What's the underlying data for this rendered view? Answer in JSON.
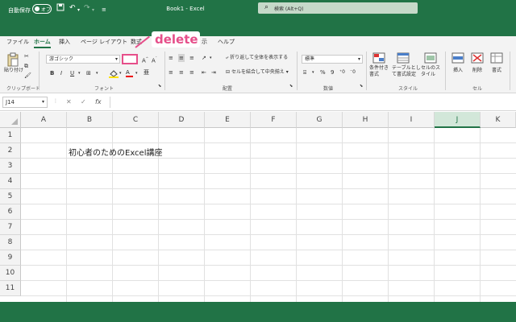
{
  "titlebar": {
    "autosave_label": "自動保存",
    "autosave_state": "オフ",
    "doc_title": "Book1 - Excel",
    "search_placeholder": "検索 (Alt+Q)"
  },
  "menu": {
    "tabs": [
      {
        "label": "ファイル"
      },
      {
        "label": "ホーム"
      },
      {
        "label": "挿入"
      },
      {
        "label": "ページ レイアウト"
      },
      {
        "label": "数式"
      },
      {
        "label": "示"
      },
      {
        "label": "ヘルプ"
      }
    ]
  },
  "ribbon": {
    "paste_label": "貼り付け",
    "clipboard_group": "クリップボード",
    "font_name": "游ゴシック",
    "font_group": "フォント",
    "wrap_text": "折り返して全体を表示する",
    "merge_center": "セルを結合して中央揃え",
    "alignment_group": "配置",
    "number_format": "標準",
    "number_group": "数値",
    "conditional_format": "条件付き書式",
    "table_format": "テーブルとして書式設定",
    "cell_styles": "セルのスタイル",
    "styles_group": "スタイル",
    "insert_label": "挿入",
    "delete_label": "削除",
    "format_label": "書式",
    "cells_group": "セル"
  },
  "annotation": {
    "text": "delete",
    "color": "#e64f8a"
  },
  "formulabar": {
    "namebox_value": "J14",
    "fx_label": "fx"
  },
  "grid": {
    "columns": [
      "A",
      "B",
      "C",
      "D",
      "E",
      "F",
      "G",
      "H",
      "I",
      "J",
      "K"
    ],
    "selected_column": "J",
    "rows": [
      "1",
      "2",
      "3",
      "4",
      "5",
      "6",
      "7",
      "8",
      "9",
      "10",
      "11"
    ],
    "cell_b2": "初心者のためのExcel講座"
  },
  "colors": {
    "accent": "#217346",
    "ribbon_bg": "#f3f3f3"
  }
}
